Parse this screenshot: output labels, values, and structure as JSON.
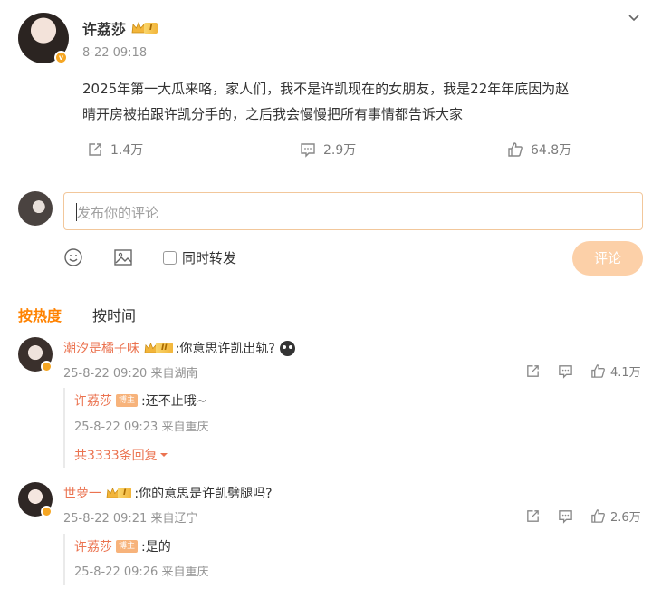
{
  "post": {
    "author": "许荔莎",
    "level_badge": "I",
    "vip_badge": "v",
    "time": "8-22 09:18",
    "content_line1": "2025年第一大瓜来咯，家人们，我不是许凯现在的女朋友，我是22年年底因为赵",
    "content_line2": "晴开房被拍跟许凯分手的，之后我会慢慢把所有事情都告诉大家",
    "repost_count": "1.4万",
    "comment_count": "2.9万",
    "like_count": "64.8万"
  },
  "composer": {
    "placeholder": "发布你的评论",
    "repost_label": "同时转发",
    "submit_label": "评论"
  },
  "sort_tabs": {
    "hot": "按热度",
    "time": "按时间"
  },
  "comments": [
    {
      "name": "潮汐是橘子味",
      "level_badge": "II",
      "text": ":你意思许凯出轨?",
      "meta": "25-8-22 09:20 来自湖南",
      "likes": "4.1万",
      "reply": {
        "name": "许荔莎",
        "tag": "博主",
        "text": ":还不止哦~",
        "meta": "25-8-22 09:23 来自重庆"
      },
      "more_replies": "共3333条回复"
    },
    {
      "name": "世萝一",
      "level_badge": "I",
      "text": ":你的意思是许凯劈腿吗?",
      "meta": "25-8-22 09:21 来自辽宁",
      "likes": "2.6万",
      "reply": {
        "name": "许荔莎",
        "tag": "博主",
        "text": ":是的",
        "meta": "25-8-22 09:26 来自重庆"
      }
    }
  ],
  "colors": {
    "accent": "#ff8200",
    "username": "#eb7350",
    "submit_bg": "#fcd0a8"
  }
}
